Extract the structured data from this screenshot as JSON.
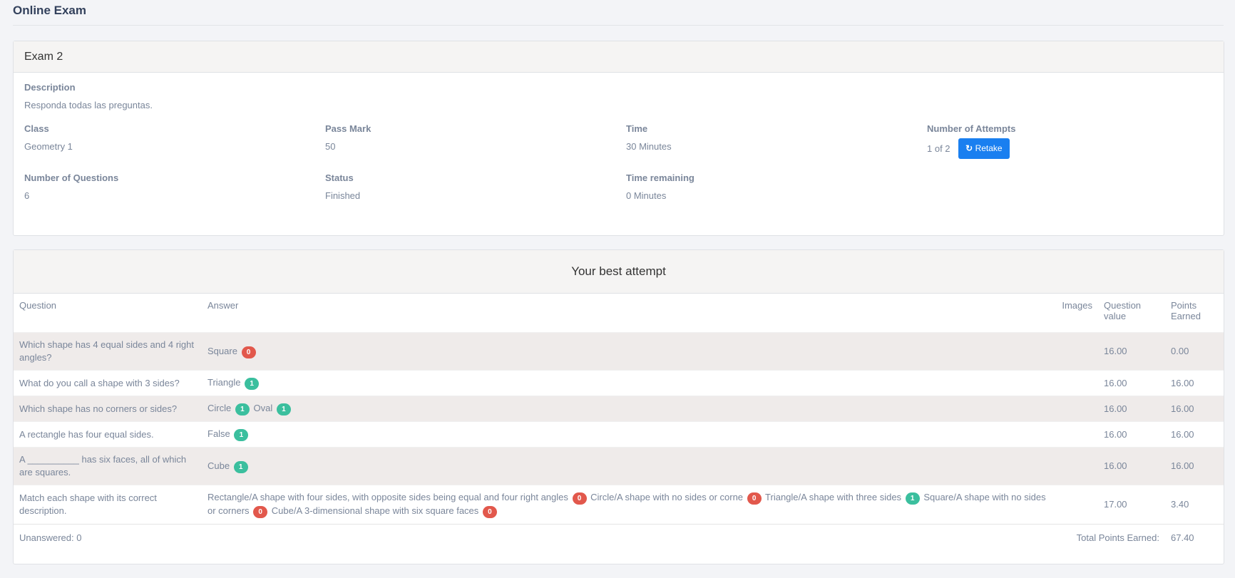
{
  "page_title": "Online Exam",
  "exam": {
    "name": "Exam 2",
    "description_label": "Description",
    "description": "Responda todas las preguntas.",
    "class_label": "Class",
    "class": "Geometry 1",
    "pass_mark_label": "Pass Mark",
    "pass_mark": "50",
    "time_label": "Time",
    "time": "30 Minutes",
    "attempts_label": "Number of Attempts",
    "attempts": "1 of 2",
    "retake_label": "Retake",
    "questions_label": "Number of Questions",
    "questions": "6",
    "status_label": "Status",
    "status": "Finished",
    "time_remaining_label": "Time remaining",
    "time_remaining": "0 Minutes"
  },
  "attempt": {
    "heading": "Your best attempt",
    "columns": [
      "Question",
      "Answer",
      "Images",
      "Question value",
      "Points Earned"
    ],
    "rows": [
      {
        "question": "Which shape has 4 equal sides and 4 right angles?",
        "answers": [
          {
            "text": "Square",
            "score": "0",
            "ok": false
          }
        ],
        "value": "16.00",
        "earned": "0.00"
      },
      {
        "question": "What do you call a shape with 3 sides?",
        "answers": [
          {
            "text": "Triangle",
            "score": "1",
            "ok": true
          }
        ],
        "value": "16.00",
        "earned": "16.00"
      },
      {
        "question": "Which shape has no corners or sides?",
        "answers": [
          {
            "text": "Circle",
            "score": "1",
            "ok": true
          },
          {
            "text": "Oval",
            "score": "1",
            "ok": true
          }
        ],
        "value": "16.00",
        "earned": "16.00"
      },
      {
        "question": "A rectangle has four equal sides.",
        "answers": [
          {
            "text": "False",
            "score": "1",
            "ok": true
          }
        ],
        "value": "16.00",
        "earned": "16.00"
      },
      {
        "question": "A __________ has six faces, all of which are squares.",
        "answers": [
          {
            "text": "Cube",
            "score": "1",
            "ok": true
          }
        ],
        "value": "16.00",
        "earned": "16.00"
      },
      {
        "question": "Match each shape with its correct description.",
        "answers": [
          {
            "text": "Rectangle/A shape with four sides, with opposite sides being equal and four right angles",
            "score": "0",
            "ok": false
          },
          {
            "text": "Circle/A shape with no sides or corne",
            "score": "0",
            "ok": false
          },
          {
            "text": "Triangle/A shape with three sides",
            "score": "1",
            "ok": true
          },
          {
            "text": "Square/A shape with no sides or corners",
            "score": "0",
            "ok": false
          },
          {
            "text": "Cube/A 3-dimensional shape with six square faces",
            "score": "0",
            "ok": false
          }
        ],
        "value": "17.00",
        "earned": "3.40"
      }
    ],
    "unanswered": "Unanswered: 0",
    "total_label": "Total Points Earned:",
    "total": "67.40"
  },
  "colors": {
    "accent": "#1a7ff0",
    "bad": "#e2584c",
    "good": "#3bbf9e"
  }
}
